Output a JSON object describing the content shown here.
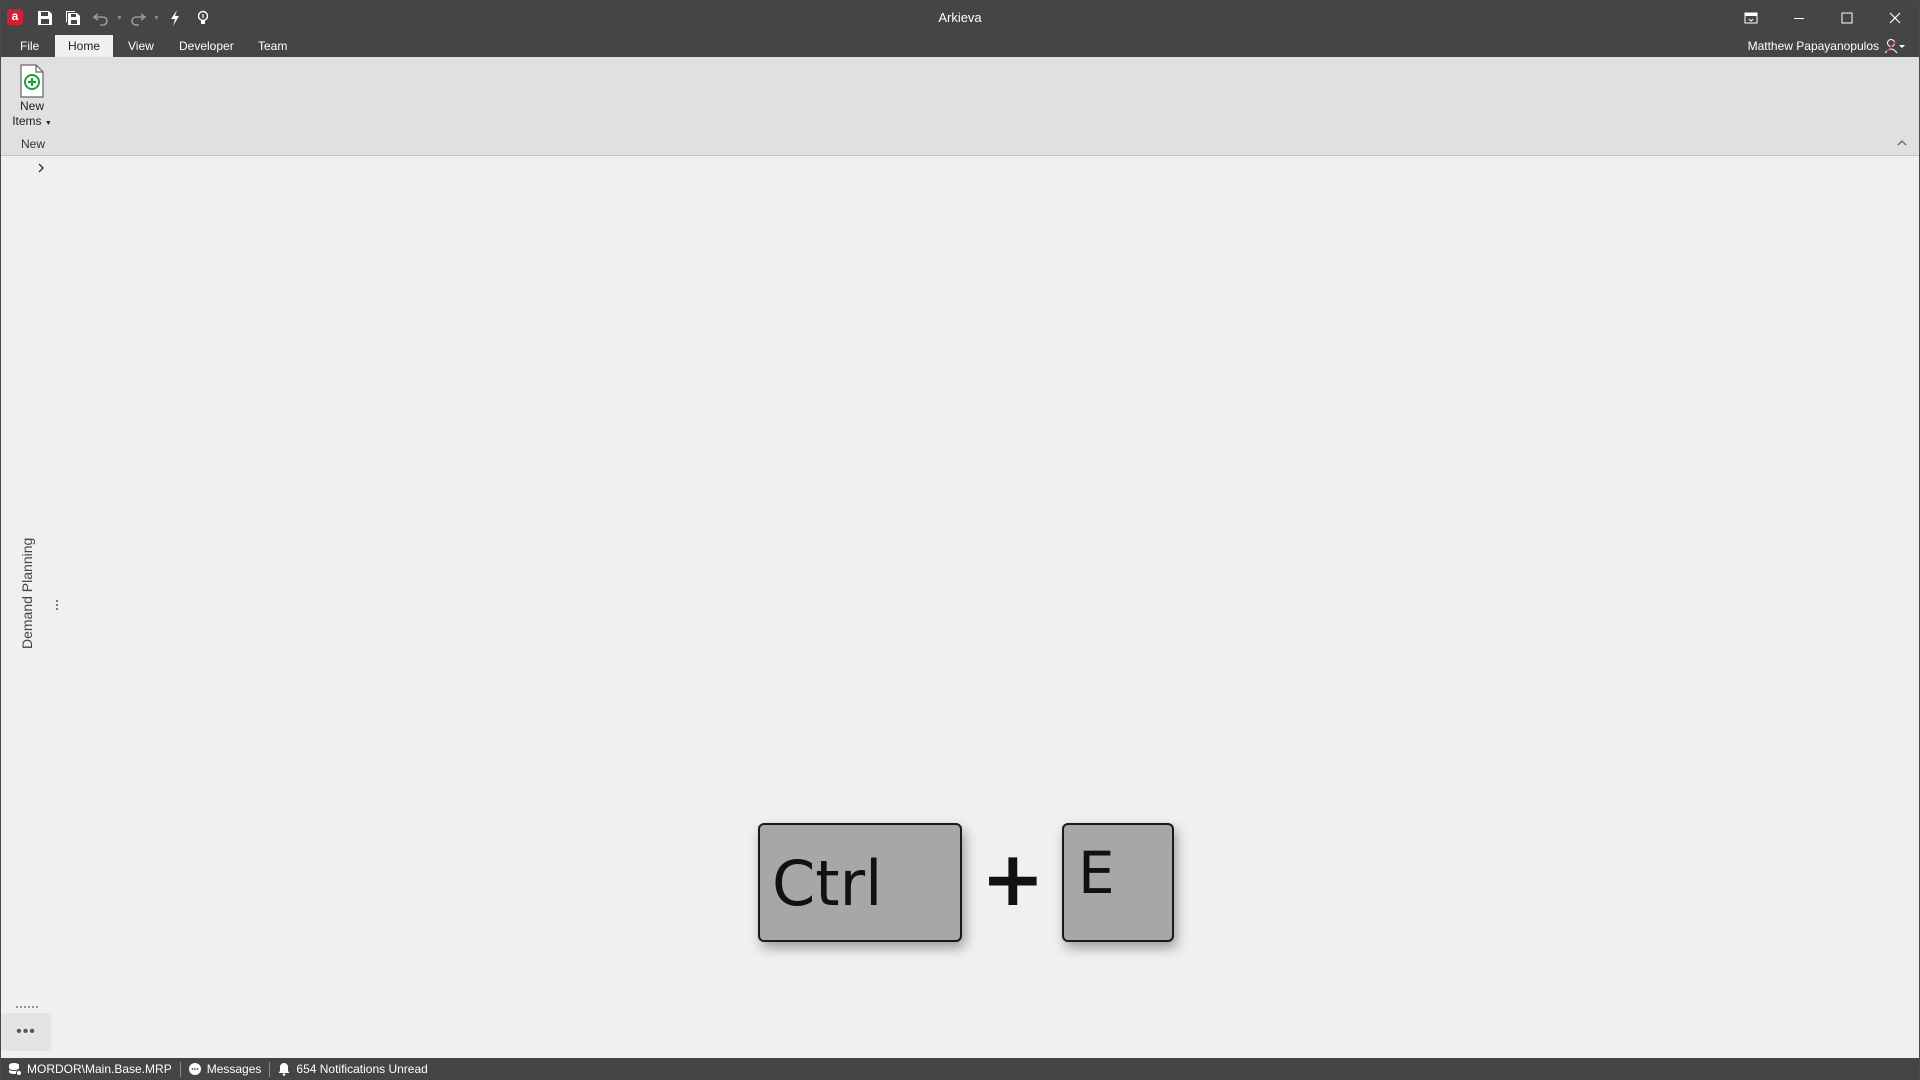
{
  "app": {
    "title": "Arkieva",
    "logo_letter": "a",
    "accent_color": "#d31f35"
  },
  "quick_access": {
    "items": [
      "save-icon",
      "save-all-icon",
      "undo-icon",
      "redo-icon",
      "lightning-icon",
      "lightbulb-icon"
    ]
  },
  "menu": {
    "tabs": [
      {
        "label": "File"
      },
      {
        "label": "Home"
      },
      {
        "label": "View"
      },
      {
        "label": "Developer"
      },
      {
        "label": "Team"
      }
    ],
    "active_tab": "Home"
  },
  "user": {
    "name": "Matthew Papayanopulos"
  },
  "ribbon": {
    "new_items_line1": "New",
    "new_items_line2": "Items",
    "group_label": "New"
  },
  "side_panel": {
    "label": "Demand Planning",
    "more_label": "•••"
  },
  "overlay": {
    "key1": "Ctrl",
    "plus": "+",
    "key2": "E"
  },
  "status": {
    "database": "MORDOR\\Main.Base.MRP",
    "messages": "Messages",
    "notifications": "654 Notifications Unread"
  }
}
